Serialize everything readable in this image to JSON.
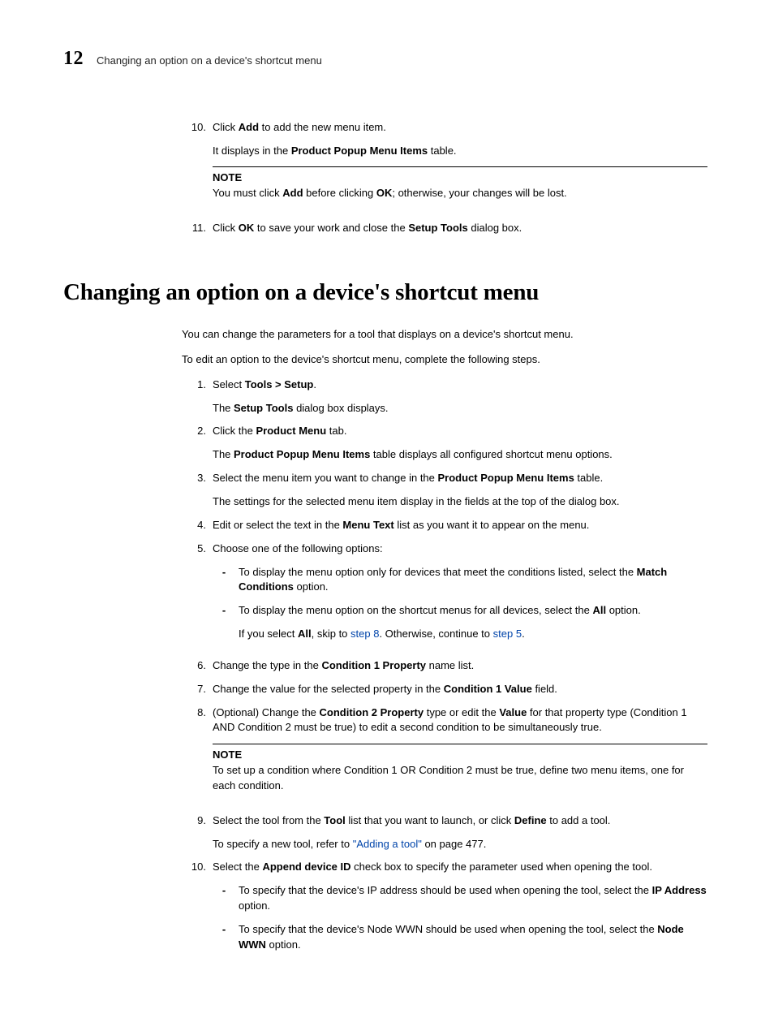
{
  "header": {
    "chapter": "12",
    "running_title": "Changing an option on a device's shortcut menu"
  },
  "top_steps": {
    "s10": {
      "num": "10.",
      "text_pre": "Click ",
      "add": "Add",
      "text_post": " to add the new menu item.",
      "line2_pre": "It displays in the ",
      "ppmi": "Product Popup Menu Items",
      "line2_post": " table."
    },
    "note": {
      "label": "NOTE",
      "pre": "You must click ",
      "add": "Add",
      "mid": " before clicking ",
      "ok": "OK",
      "post": "; otherwise, your changes will be lost."
    },
    "s11": {
      "num": "11.",
      "pre": "Click ",
      "ok": "OK",
      "mid": " to save your work and close the ",
      "setup": "Setup Tools",
      "post": " dialog box."
    }
  },
  "heading": "Changing an option on a device's shortcut menu",
  "intro": {
    "p1": "You can change the parameters for a tool that displays on a device's shortcut menu.",
    "p2": "To edit an option to the device's shortcut menu, complete the following steps."
  },
  "steps": {
    "s1": {
      "num": "1.",
      "pre": "Select ",
      "bold": "Tools > Setup",
      "post": ".",
      "line2_pre": "The ",
      "line2_bold": "Setup Tools",
      "line2_post": " dialog box displays."
    },
    "s2": {
      "num": "2.",
      "pre": "Click the ",
      "bold": "Product Menu",
      "post": " tab.",
      "line2_pre": "The ",
      "line2_bold": "Product Popup Menu Items",
      "line2_post": " table displays all configured shortcut menu options."
    },
    "s3": {
      "num": "3.",
      "pre": "Select the menu item you want to change in the ",
      "bold": "Product Popup Menu Items",
      "post": " table.",
      "line2": "The settings for the selected menu item display in the fields at the top of the dialog box."
    },
    "s4": {
      "num": "4.",
      "pre": "Edit or select the text in the ",
      "bold": "Menu Text",
      "post": " list as you want it to appear on the menu."
    },
    "s5": {
      "num": "5.",
      "text": "Choose one of the following options:",
      "b1": {
        "pre": "To display the menu option only for devices that meet the conditions listed, select the ",
        "bold": "Match Conditions",
        "post": " option."
      },
      "b2": {
        "pre": "To display the menu option on the shortcut menus for all devices, select the ",
        "bold": "All",
        "post": " option."
      },
      "b2_sub": {
        "pre": "If you select ",
        "all": "All",
        "mid1": ", skip to ",
        "link1": "step 8",
        "mid2": ". Otherwise, continue to ",
        "link2": "step 5",
        "post": "."
      }
    },
    "s6": {
      "num": "6.",
      "pre": "Change the type in the ",
      "bold": "Condition 1 Property",
      "post": " name list."
    },
    "s7": {
      "num": "7.",
      "pre": "Change the value for the selected property in the ",
      "bold": "Condition 1 Value",
      "post": " field."
    },
    "s8": {
      "num": "8.",
      "pre": "(Optional) Change the ",
      "bold1": "Condition 2 Property",
      "mid": " type or edit the ",
      "bold2": "Value",
      "post": " for that property type (Condition 1 AND Condition 2 must be true) to edit a second condition to be simultaneously true."
    },
    "note2": {
      "label": "NOTE",
      "text": "To set up a condition where Condition 1 OR Condition 2 must be true, define two menu items, one for each condition."
    },
    "s9": {
      "num": "9.",
      "pre": "Select the tool from the ",
      "bold1": "Tool",
      "mid": " list that you want to launch, or click ",
      "bold2": "Define",
      "post": " to add a tool.",
      "line2_pre": "To specify a new tool, refer to ",
      "link": "\"Adding a tool\"",
      "line2_post": " on page 477."
    },
    "s10": {
      "num": "10.",
      "pre": "Select the ",
      "bold": "Append device ID",
      "post": " check box to specify the parameter used when opening the tool.",
      "b1": {
        "pre": "To specify that the device's IP address should be used when opening the tool, select the ",
        "bold": "IP Address",
        "post": " option."
      },
      "b2": {
        "pre": "To specify that the device's Node WWN should be used when opening the tool, select the ",
        "bold": "Node WWN",
        "post": " option."
      }
    }
  }
}
